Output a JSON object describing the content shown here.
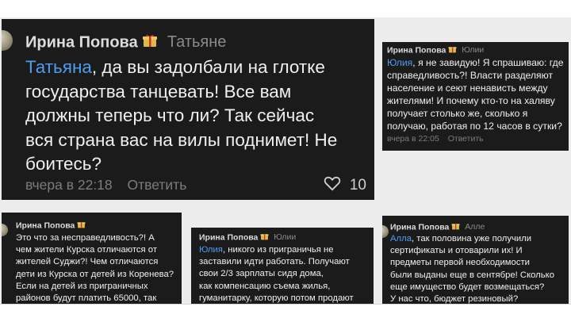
{
  "comments": [
    {
      "author": "Ирина Попова",
      "reply_to": "Татьяне",
      "mention": "Татьяна",
      "text_lines": [
        ", да вы задолбали на глотке",
        "государства танцевать! Все вам",
        "должны теперь что ли? Так сейчас",
        "вся страна вас на вилы поднимет! Не",
        "боитесь?"
      ],
      "time": "вчера в 22:18",
      "reply_label": "Ответить",
      "likes": "10"
    },
    {
      "author": "Ирина Попова",
      "reply_to": "Юлии",
      "mention": "Юлия",
      "text_lines": [
        ", я не завидую! Я спрашиваю: где",
        "справедливость?! Власти разделяют",
        "население и сеют ненависть между",
        "жителями! И почему кто-то на халяву",
        "получает столько же, сколько я",
        "получаю, работая по 12 часов в сутки?"
      ],
      "time": "вчера в 22:05",
      "reply_label": "Ответить"
    },
    {
      "author": "Ирина Попова",
      "text_lines": [
        "Это что за несправедливость?! А",
        "чем жители Курска отличаются от",
        "жителей Суджи?! Чем отличаются",
        "дети из Курска от детей из Коренева?",
        "Если на детей из приграничных",
        "районов будут платить 65000, так"
      ]
    },
    {
      "author": "Ирина Попова",
      "reply_to": "Юлии",
      "mention": "Юлия",
      "text_lines": [
        ", никого из приграничья не",
        "заставили идти работать. Получают",
        "свои 2/3 зарплаты сидя дома,",
        "как компенсацию съема жилья,",
        "гуманитарку, которую потом продают"
      ]
    },
    {
      "author": "Ирина Попова",
      "reply_to": "Алле",
      "mention": "Алла",
      "text_lines": [
        ", так половина уже получили",
        "сертификаты и отоварили их! И",
        "предметы первой необходимости",
        "были выданы еще в сентябре! Сколько",
        "еще имущество будет возмещаться?",
        "У нас что, бюджет резиновый?"
      ]
    }
  ],
  "icons": {
    "gift": "gift-icon",
    "like": "heart-icon"
  },
  "colors": {
    "card_bg": "#1b1b1b",
    "mention": "#4f9cf0",
    "meta": "#7c7c7c",
    "gift": "#e0b84a"
  }
}
